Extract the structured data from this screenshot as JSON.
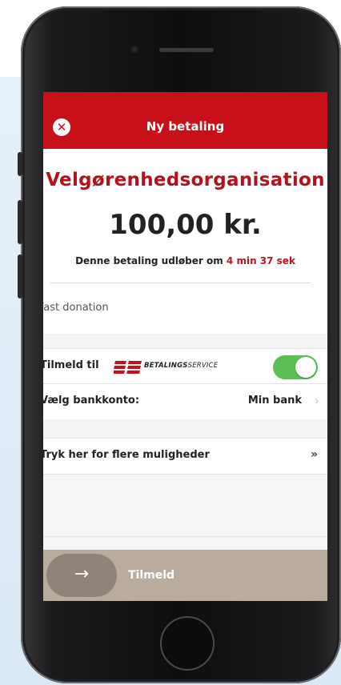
{
  "header": {
    "title": "Ny betaling",
    "close_icon": "close-icon"
  },
  "payment": {
    "recipient": "Velgørenhedsorganisation",
    "amount": "100,00 kr.",
    "expiry_prefix": "Denne betaling udløber om",
    "expiry_timer": "4 min 37 sek",
    "description": "Fast donation"
  },
  "signup": {
    "label": "Tilmeld til",
    "logo_bold": "BETALINGS",
    "logo_light": "SERVICE",
    "toggle_on": true
  },
  "bank": {
    "label": "Vælg bankkonto:",
    "value": "Min bank"
  },
  "more": {
    "label": "Tryk her for flere muligheder"
  },
  "footer": {
    "arrow_icon": "arrow-right-icon",
    "submit_label": "Tilmeld"
  },
  "colors": {
    "brand_red": "#c8101b",
    "toggle_green": "#5cbf56",
    "footer_bg": "#b9ab9d"
  }
}
